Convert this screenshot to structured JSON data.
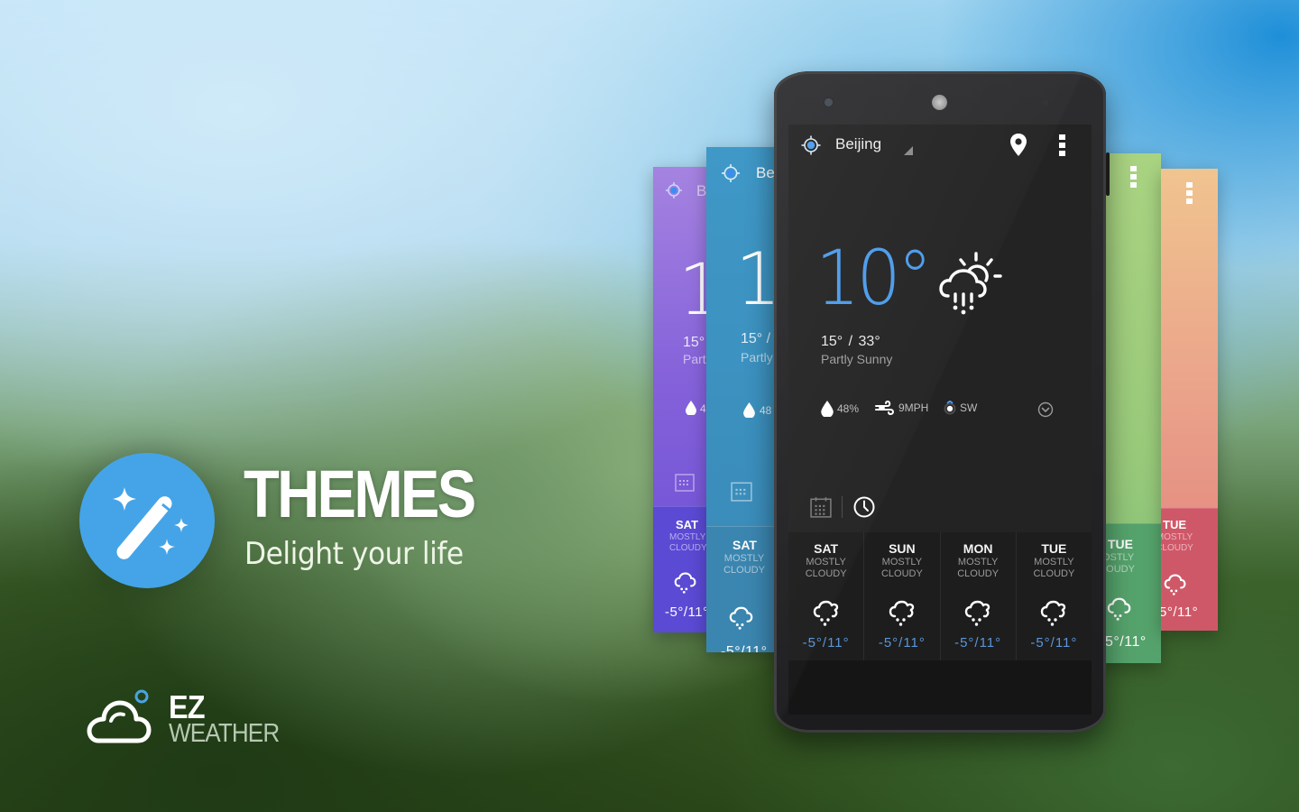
{
  "promo": {
    "title": "THEMES",
    "subtitle": "Delight your life",
    "badge_icon": "magic-wand-icon",
    "badge_color": "#45a4e8"
  },
  "brand": {
    "line1": "EZ",
    "line2": "WEATHER",
    "logo_icon": "cloud-icon",
    "accent_color": "#4aa3e2"
  },
  "phone_screen": {
    "city": "Beijing",
    "current_temp": "10°",
    "temp_range": "15° / 33°",
    "condition": "Partly Sunny",
    "condition_icon": "partly-sunny-rain-icon",
    "stats": {
      "humidity": "48%",
      "wind_speed": "9MPH",
      "wind_direction": "SW"
    },
    "accent_color": "#4b9bea",
    "forecast": [
      {
        "day": "SAT",
        "cond1": "MOSTLY",
        "cond2": "CLOUDY",
        "temp": "-5°/11°"
      },
      {
        "day": "SUN",
        "cond1": "MOSTLY",
        "cond2": "CLOUDY",
        "temp": "-5°/11°"
      },
      {
        "day": "MON",
        "cond1": "MOSTLY",
        "cond2": "CLOUDY",
        "temp": "-5°/11°"
      },
      {
        "day": "TUE",
        "cond1": "MOSTLY",
        "cond2": "CLOUDY",
        "temp": "-5°/11°"
      }
    ]
  },
  "theme_cards": {
    "purple": {
      "loc": "B",
      "big": "1",
      "range": "15°",
      "desc": "Parti",
      "hum": "4",
      "day": "SAT",
      "cond1": "MOSTLY",
      "cond2": "CLOUDY",
      "temp": "-5°/11°",
      "color": "#7a5adb"
    },
    "blue": {
      "loc": "Be",
      "big": "1",
      "range": "15°  /",
      "desc": "Partly",
      "hum": "48",
      "day": "SAT",
      "cond1": "MOSTLY",
      "cond2": "CLOUDY",
      "temp": "-5°/11°",
      "color": "#3b8fbd"
    },
    "green": {
      "day": "TUE",
      "cond1": "MOSTLY",
      "cond2": "CLOUDY",
      "temp": "5°/11°",
      "color": "#98c97a"
    },
    "peach": {
      "day": "TUE",
      "cond1": "MOSTLY",
      "cond2": "CLOUDY",
      "temp": "5°/11°",
      "color": "#e8957f"
    }
  }
}
